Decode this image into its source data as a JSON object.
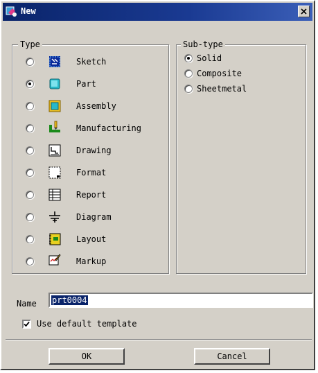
{
  "window": {
    "title": "New",
    "colors": {
      "titlebar": "#0a246a",
      "face": "#d4d0c8",
      "selection": "#0a246a"
    }
  },
  "type_group": {
    "legend": "Type",
    "selected": "Part",
    "items": [
      {
        "label": "Sketch",
        "icon": "sketch-icon",
        "checked": false
      },
      {
        "label": "Part",
        "icon": "part-icon",
        "checked": true
      },
      {
        "label": "Assembly",
        "icon": "assembly-icon",
        "checked": false
      },
      {
        "label": "Manufacturing",
        "icon": "manufacturing-icon",
        "checked": false
      },
      {
        "label": "Drawing",
        "icon": "drawing-icon",
        "checked": false
      },
      {
        "label": "Format",
        "icon": "format-icon",
        "checked": false
      },
      {
        "label": "Report",
        "icon": "report-icon",
        "checked": false
      },
      {
        "label": "Diagram",
        "icon": "diagram-icon",
        "checked": false
      },
      {
        "label": "Layout",
        "icon": "layout-icon",
        "checked": false
      },
      {
        "label": "Markup",
        "icon": "markup-icon",
        "checked": false
      }
    ]
  },
  "subtype_group": {
    "legend": "Sub-type",
    "selected": "Solid",
    "items": [
      {
        "label": "Solid",
        "checked": true
      },
      {
        "label": "Composite",
        "checked": false
      },
      {
        "label": "Sheetmetal",
        "checked": false
      }
    ]
  },
  "name": {
    "label": "Name",
    "value": "prt0004"
  },
  "use_default_template": {
    "label": "Use default template",
    "checked": true
  },
  "buttons": {
    "ok": "OK",
    "cancel": "Cancel"
  }
}
